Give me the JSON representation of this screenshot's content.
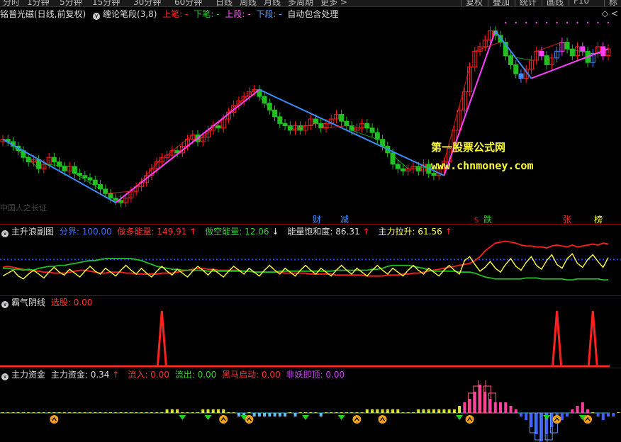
{
  "toolbar": {
    "tabs": [
      "分时",
      "1分钟",
      "5分钟",
      "15分钟",
      "30分钟",
      "60分钟",
      "日线",
      "周线",
      "月线",
      "多周期",
      "更多 >"
    ],
    "right_buttons": [
      "复权",
      "叠加",
      "统计",
      "画线",
      "F10",
      "标记"
    ]
  },
  "main_header": {
    "title": "铭普光磁(日线,前复权)",
    "indicator": "缠论笔段(3,8)",
    "up_bi": "上笔: -",
    "down_bi": "下笔: -",
    "up_duan": "上段: -",
    "down_duan": "下段: -",
    "auto": "自动包含处理"
  },
  "watermark": {
    "line1": "第一股票公式网",
    "line2": "www.chnmoney.com"
  },
  "bottom_left_text": "中国人之长证",
  "event_labels": [
    "财",
    "减",
    "跌",
    "张",
    "榜"
  ],
  "event_mark_s": "S",
  "panel2": {
    "title": "主升浪副图",
    "fenjie": "分界: 100.00",
    "zuoduo": "做多能量: 149.91",
    "zuoduo_arrow": "↑",
    "zuokong": "做空能量: 12.06",
    "zuokong_arrow": "↓",
    "baohe": "能量饱和度: 86.31",
    "baohe_arrow": "↑",
    "lasheng": "主力拉升: 61.56",
    "lasheng_arrow": "↑"
  },
  "panel3": {
    "title": "霸气阴线",
    "xuangu": "选股: 0.00"
  },
  "panel4": {
    "title": "主力资金",
    "zhuli": "主力资金: 0.34",
    "zhuli_arrow": "↑",
    "liuru": "流入: 0.00",
    "liuchu": "流出: 0.00",
    "heima": "黑马启动: 0.00",
    "feiyao": "非妖即顶: 0.00"
  },
  "colors": {
    "up": "#ff2020",
    "down": "#20c020",
    "magenta": "#ff40ff",
    "blue": "#3c8cff",
    "yellow": "#ffff40",
    "gray": "#ccc"
  },
  "chart_data": [
    {
      "type": "candlestick",
      "title": "铭普光磁(日线,前复权)",
      "close": [
        51,
        50,
        48,
        46,
        43,
        41,
        42,
        38,
        40,
        43,
        41,
        39,
        37,
        39,
        36,
        35,
        34,
        33,
        31,
        29,
        27,
        25,
        24,
        23,
        25,
        28,
        30,
        32,
        35,
        38,
        41,
        43,
        44,
        46,
        45,
        48,
        51,
        53,
        50,
        52,
        55,
        57,
        56,
        60,
        63,
        66,
        68,
        70,
        72,
        73,
        70,
        67,
        64,
        61,
        58,
        57,
        55,
        57,
        55,
        57,
        60,
        58,
        56,
        58,
        60,
        62,
        59,
        57,
        55,
        56,
        58,
        56,
        54,
        51,
        48,
        45,
        40,
        38,
        37,
        38,
        39,
        37,
        40,
        36,
        35,
        38,
        41,
        47,
        55,
        64,
        72,
        83,
        90,
        92,
        95,
        99,
        97,
        94,
        88,
        84,
        80,
        78,
        82,
        86,
        90,
        88,
        84,
        87,
        90,
        94,
        91,
        88,
        92,
        90,
        85,
        89,
        92,
        88,
        91
      ],
      "highlight_bar": 88
    },
    {
      "type": "line",
      "title": "主升浪副图",
      "series": [
        {
          "name": "做多能量",
          "values": [
            49,
            50,
            49,
            48,
            47,
            46,
            45,
            45,
            44,
            44,
            43,
            43,
            43,
            44,
            45,
            46,
            46,
            45,
            44,
            43,
            43,
            44,
            44,
            44,
            43,
            43,
            42,
            42,
            42,
            42,
            42,
            43,
            43,
            43,
            44,
            45,
            46,
            47,
            48,
            48,
            47,
            47,
            46,
            46,
            46,
            46,
            46,
            45,
            45,
            44,
            44,
            44,
            44,
            44,
            44,
            43,
            43,
            43,
            43,
            43,
            42,
            42,
            42,
            42,
            42,
            41,
            41,
            41,
            41,
            41,
            41,
            40,
            40,
            40,
            40,
            41,
            41,
            41,
            42,
            42,
            43,
            43,
            44,
            45,
            46,
            47,
            48,
            49,
            50,
            51,
            52,
            53,
            56,
            60,
            66,
            70,
            74,
            75,
            76,
            75,
            74,
            72,
            71,
            71,
            70,
            70,
            69,
            71,
            72,
            71,
            70,
            72,
            70,
            71,
            72,
            73,
            72,
            74,
            73
          ]
        },
        {
          "name": "做空能量",
          "values": [
            48,
            48,
            47,
            47,
            46,
            47,
            46,
            48,
            49,
            50,
            50,
            51,
            51,
            52,
            53,
            54,
            55,
            56,
            56,
            57,
            58,
            58,
            58,
            58,
            58,
            58,
            57,
            56,
            54,
            52,
            50,
            49,
            48,
            47,
            47,
            46,
            46,
            46,
            46,
            46,
            45,
            45,
            45,
            45,
            45,
            45,
            45,
            45,
            45,
            44,
            44,
            44,
            44,
            44,
            45,
            45,
            45,
            45,
            45,
            45,
            45,
            45,
            45,
            45,
            45,
            46,
            46,
            46,
            46,
            46,
            46,
            46,
            47,
            47,
            48,
            50,
            51,
            51,
            51,
            51,
            50,
            49,
            48,
            46,
            45,
            45,
            45,
            45,
            45,
            44,
            44,
            44,
            43,
            41,
            39,
            38,
            37,
            37,
            37,
            37,
            37,
            37,
            38,
            38,
            38,
            37,
            37,
            37,
            37,
            37,
            36,
            36,
            37,
            37,
            37,
            37,
            37,
            36,
            36
          ]
        },
        {
          "name": "能量饱和度",
          "values": [
            40,
            43,
            46,
            40,
            37,
            42,
            46,
            42,
            38,
            44,
            49,
            44,
            41,
            47,
            43,
            39,
            45,
            50,
            45,
            42,
            48,
            44,
            40,
            46,
            51,
            46,
            42,
            48,
            43,
            39,
            45,
            50,
            45,
            41,
            47,
            43,
            39,
            45,
            50,
            46,
            41,
            47,
            43,
            39,
            45,
            50,
            46,
            42,
            48,
            44,
            40,
            46,
            51,
            46,
            42,
            48,
            44,
            40,
            46,
            51,
            46,
            42,
            48,
            44,
            40,
            46,
            51,
            46,
            42,
            48,
            44,
            40,
            46,
            51,
            46,
            42,
            48,
            44,
            40,
            46,
            51,
            46,
            42,
            48,
            44,
            40,
            46,
            51,
            46,
            42,
            56,
            60,
            52,
            45,
            49,
            55,
            48,
            44,
            52,
            58,
            50,
            46,
            54,
            60,
            51,
            47,
            56,
            62,
            52,
            48,
            58,
            63,
            53,
            49,
            57,
            62,
            55,
            49,
            59
          ]
        },
        {
          "name": "主力拉升",
          "values": [
            32,
            34,
            37,
            33,
            36,
            38,
            34,
            30,
            33,
            36,
            33,
            31,
            34,
            36,
            33,
            30,
            33,
            36,
            33,
            31,
            34,
            36,
            33,
            30,
            33,
            36,
            33,
            31,
            34,
            36,
            33,
            30,
            33,
            36,
            33,
            31,
            34,
            36,
            33,
            30,
            33,
            36,
            33,
            31,
            34,
            36,
            33,
            30,
            33,
            36,
            33,
            31,
            34,
            36,
            33,
            30,
            33,
            36,
            33,
            31,
            34,
            36,
            33,
            30,
            33,
            36,
            33,
            31,
            34,
            36,
            33,
            30,
            33,
            36,
            33,
            31,
            34,
            36,
            33,
            30,
            33,
            36,
            33,
            31,
            34,
            36,
            33,
            30,
            33,
            36,
            33,
            31,
            34,
            36,
            33,
            30,
            33,
            36,
            33,
            31,
            34,
            36,
            33,
            30,
            33,
            36,
            33,
            31,
            34,
            36,
            33,
            30,
            33,
            36,
            33,
            31,
            34,
            36,
            33
          ]
        }
      ],
      "fenjie": 100
    },
    {
      "type": "line",
      "title": "霸气阴线",
      "spikes": [
        31,
        108,
        115
      ],
      "ylim": [
        0,
        1
      ]
    },
    {
      "type": "bar",
      "title": "主力资金",
      "values": [
        0,
        0,
        0,
        0,
        0,
        0,
        0,
        0,
        0,
        0,
        0,
        0,
        0,
        0,
        0,
        0,
        0,
        0,
        0,
        0,
        0,
        0,
        0,
        0,
        0,
        0,
        0,
        0,
        0,
        0,
        0,
        0,
        1,
        1,
        1,
        0,
        0,
        0,
        0,
        1,
        1,
        1,
        1,
        1,
        0,
        0,
        -1,
        -1,
        0,
        -1,
        -1,
        -1,
        -1,
        -1,
        -1,
        -1,
        0,
        -1,
        0,
        0,
        0,
        0,
        -1,
        0,
        0,
        0,
        0,
        0,
        0,
        0,
        0,
        1,
        1,
        1,
        1,
        1,
        1,
        1,
        0,
        0,
        0,
        1,
        1,
        1,
        1,
        1,
        1,
        1,
        1,
        2,
        3,
        4,
        6,
        8,
        6,
        4,
        3,
        3,
        3,
        2,
        1,
        -1,
        -2,
        -4,
        -6,
        -8,
        -6,
        -4,
        -3,
        -2,
        -1,
        1,
        2,
        3,
        1,
        0,
        -1,
        -2,
        -1,
        -1,
        0,
        1,
        1,
        1,
        0
      ]
    }
  ]
}
